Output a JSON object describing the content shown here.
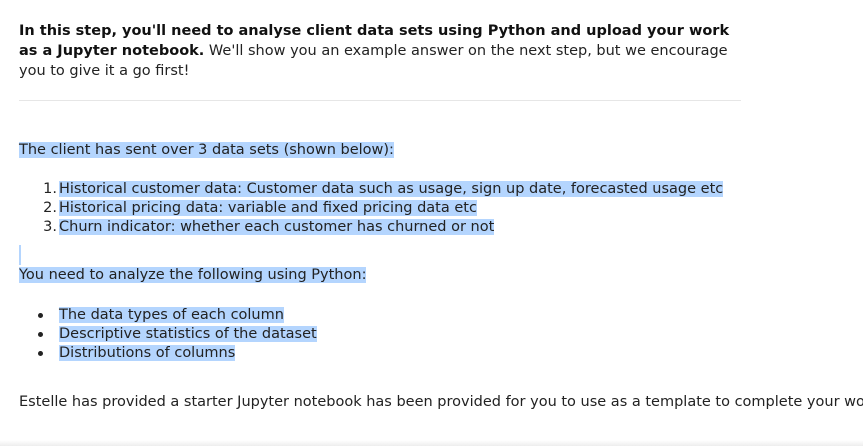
{
  "intro": {
    "bold": "In this step, you'll need to analyse client data sets using Python and upload your work as a Jupyter notebook.",
    "rest": " We'll show you an example answer on the next step, but we encourage you to give it a go first!"
  },
  "data_sets": {
    "heading": "The client has sent over 3 data sets (shown below):",
    "items": [
      {
        "number": "1.",
        "text": "Historical customer data: Customer data such as usage, sign up date, forecasted usage etc"
      },
      {
        "number": "2.",
        "text": "Historical pricing data: variable and fixed pricing data etc"
      },
      {
        "number": "3.",
        "text": "Churn indicator: whether each customer has churned or not"
      }
    ]
  },
  "analysis": {
    "heading": "You need to analyze the following using Python:",
    "items": [
      "The data types of each column",
      "Descriptive statistics of the dataset",
      "Distributions of columns"
    ]
  },
  "starter": {
    "text": "Estelle has provided a starter Jupyter notebook has been provided for you to use as a template to complete your work."
  },
  "colors": {
    "selection": "#b4d5fe",
    "text": "#222222",
    "divider": "#e6e6e6"
  }
}
